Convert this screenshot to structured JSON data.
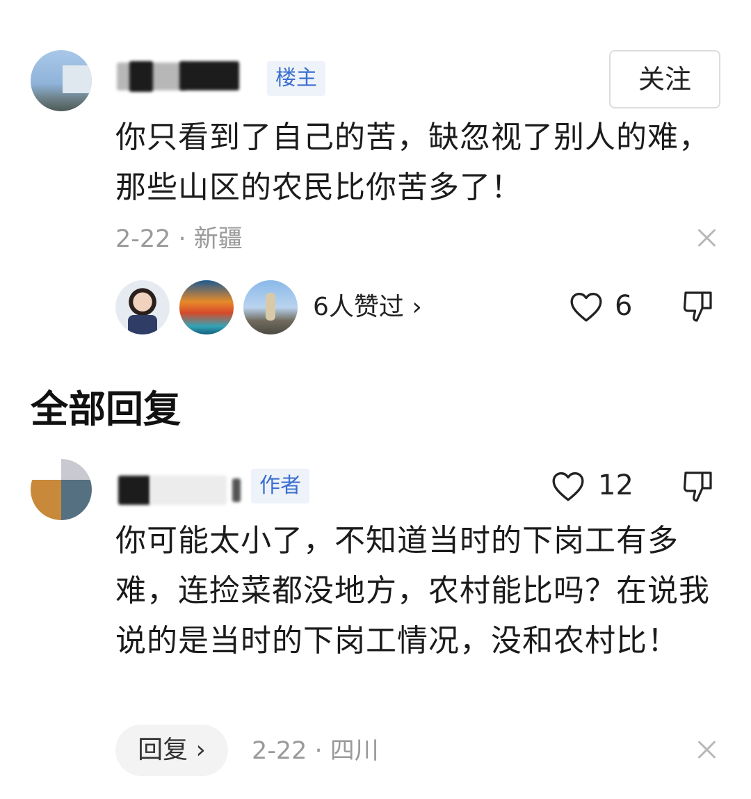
{
  "op_comment": {
    "badge": "楼主",
    "follow_label": "关注",
    "text": "你只看到了自己的苦，缺忽视了别人的难，那些山区的农民比你苦多了！",
    "meta": "2-22 · 新疆",
    "likers_text": "6人赞过 ›",
    "like_count": "6",
    "icons": {
      "like": "heart-outline-icon",
      "dislike": "thumb-down-icon",
      "close": "close-icon"
    }
  },
  "section": {
    "title": "全部回复"
  },
  "reply": {
    "badge": "作者",
    "like_count": "12",
    "text": "你可能太小了，不知道当时的下岗工有多难，连捡菜都没地方，农村能比吗？在说我说的是当时的下岗工情况，没和农村比！",
    "reply_button": "回复 ›",
    "meta": "2-22 · 四川"
  },
  "colors": {
    "badge_bg": "#eef2f9",
    "badge_text": "#3a6fd0",
    "meta_text": "#9a9a9a"
  }
}
